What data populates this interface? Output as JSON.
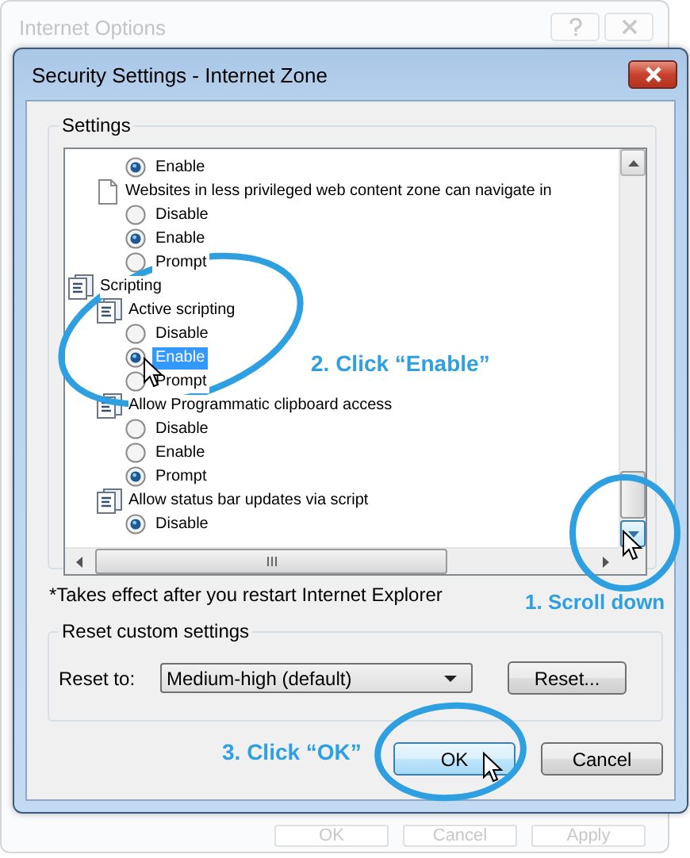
{
  "back_window": {
    "title": "Internet Options",
    "buttons": [
      "OK",
      "Cancel",
      "Apply"
    ]
  },
  "dialog": {
    "title": "Security Settings - Internet Zone",
    "settings_group": {
      "legend": "Settings",
      "tree": [
        {
          "kind": "category",
          "children": [
            {
              "kind": "script",
              "children": [
                {
                  "kind": "option",
                  "label": "Enable",
                  "checked": true,
                  "selected": false
                }
              ]
            },
            {
              "kind": "document",
              "label": "Websites in less privileged web content zone can navigate in",
              "children": [
                {
                  "kind": "option",
                  "label": "Disable",
                  "checked": false,
                  "selected": false
                },
                {
                  "kind": "option",
                  "label": "Enable",
                  "checked": true,
                  "selected": false
                },
                {
                  "kind": "option",
                  "label": "Prompt",
                  "checked": false,
                  "selected": false
                }
              ]
            }
          ]
        },
        {
          "kind": "category",
          "label": "Scripting",
          "children": [
            {
              "kind": "script",
              "label": "Active scripting",
              "children": [
                {
                  "kind": "option",
                  "label": "Disable",
                  "checked": false,
                  "selected": false
                },
                {
                  "kind": "option",
                  "label": "Enable",
                  "checked": true,
                  "selected": true
                },
                {
                  "kind": "option",
                  "label": "Prompt",
                  "checked": false,
                  "selected": false
                }
              ]
            },
            {
              "kind": "script",
              "label": "Allow Programmatic clipboard access",
              "children": [
                {
                  "kind": "option",
                  "label": "Disable",
                  "checked": false,
                  "selected": false
                },
                {
                  "kind": "option",
                  "label": "Enable",
                  "checked": false,
                  "selected": false
                },
                {
                  "kind": "option",
                  "label": "Prompt",
                  "checked": true,
                  "selected": false
                }
              ]
            },
            {
              "kind": "script",
              "label": "Allow status bar updates via script",
              "children": [
                {
                  "kind": "option",
                  "label": "Disable",
                  "checked": true,
                  "selected": false
                }
              ]
            }
          ]
        }
      ],
      "note": "*Takes effect after you restart Internet Explorer"
    },
    "reset_group": {
      "legend": "Reset custom settings",
      "label": "Reset to:",
      "dropdown": "Medium-high (default)",
      "button": "Reset..."
    },
    "buttons": [
      "OK",
      "Cancel"
    ]
  },
  "annotations": [
    "2. Click “Enable”",
    "1. Scroll down",
    "3. Click “OK”"
  ]
}
